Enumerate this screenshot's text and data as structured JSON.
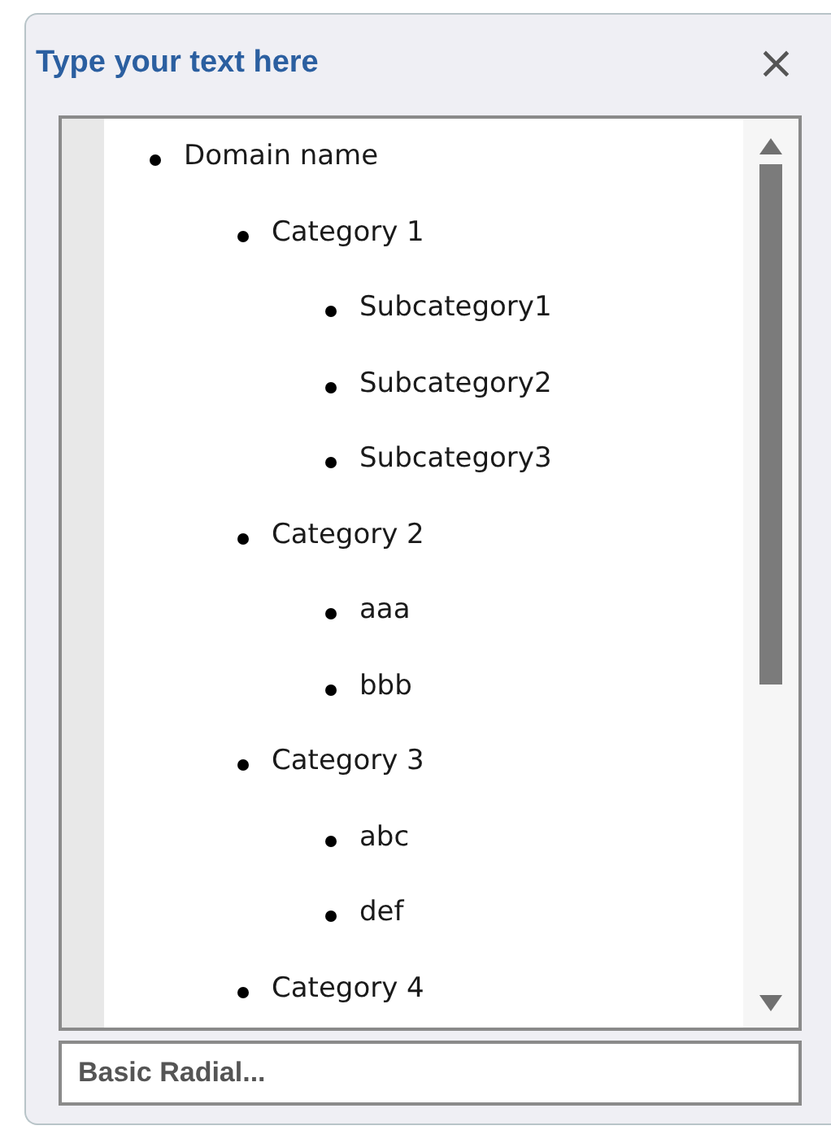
{
  "pane": {
    "title": "Type your text here",
    "close": "×"
  },
  "outline": [
    {
      "text": "Domain name",
      "children": [
        {
          "text": "Category 1",
          "children": [
            {
              "text": "Subcategory1"
            },
            {
              "text": "Subcategory2"
            },
            {
              "text": "Subcategory3"
            }
          ]
        },
        {
          "text": "Category 2",
          "children": [
            {
              "text": "aaa"
            },
            {
              "text": "bbb"
            }
          ]
        },
        {
          "text": "Category 3",
          "children": [
            {
              "text": "abc"
            },
            {
              "text": "def"
            }
          ]
        },
        {
          "text": "Category 4"
        }
      ]
    }
  ],
  "footer": {
    "text": "Basic Radial..."
  }
}
